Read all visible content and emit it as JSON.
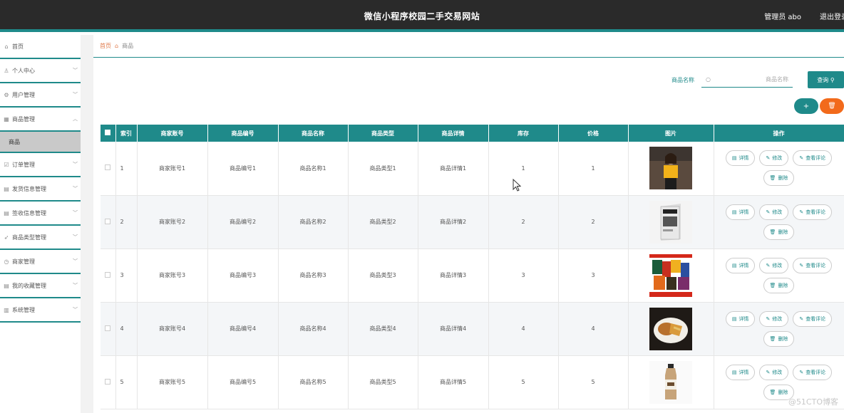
{
  "header": {
    "title": "微信小程序校园二手交易网站",
    "user": "管理员 abo",
    "logout": "退出登录"
  },
  "sidebar": {
    "items": [
      {
        "label": "首页",
        "icon": "home-icon",
        "glyph": "⌂",
        "chevron": false
      },
      {
        "label": "个人中心",
        "icon": "user-icon",
        "glyph": "♙",
        "chevron": true
      },
      {
        "label": "用户管理",
        "icon": "settings-icon",
        "glyph": "⚙",
        "chevron": true
      },
      {
        "label": "商品管理",
        "icon": "box-icon",
        "glyph": "▦",
        "chevron": true,
        "expanded": true,
        "sub": "商品"
      },
      {
        "label": "订单管理",
        "icon": "order-icon",
        "glyph": "☑",
        "chevron": true
      },
      {
        "label": "发货信息管理",
        "icon": "ship-icon",
        "glyph": "▤",
        "chevron": true
      },
      {
        "label": "签收信息管理",
        "icon": "sign-icon",
        "glyph": "▤",
        "chevron": true
      },
      {
        "label": "商品类型管理",
        "icon": "send-icon",
        "glyph": "➶",
        "chevron": true
      },
      {
        "label": "商家管理",
        "icon": "clock-icon",
        "glyph": "◷",
        "chevron": true
      },
      {
        "label": "我的收藏管理",
        "icon": "bookmark-icon",
        "glyph": "▤",
        "chevron": true
      },
      {
        "label": "系统管理",
        "icon": "system-icon",
        "glyph": "▥",
        "chevron": true
      }
    ]
  },
  "breadcrumb": {
    "home": "首页",
    "current": "商品"
  },
  "search": {
    "label": "商品名称",
    "placeholder": "商品名称",
    "button": "查询"
  },
  "actions": {
    "add": "+",
    "delete": "🗑"
  },
  "table": {
    "headers": [
      "",
      "索引",
      "商家账号",
      "商品编号",
      "商品名称",
      "商品类型",
      "商品详情",
      "库存",
      "价格",
      "图片",
      "操作"
    ],
    "rows": [
      {
        "index": "1",
        "merchant": "商家账号1",
        "code": "商品编号1",
        "name": "商品名称1",
        "type": "商品类型1",
        "detail": "商品详情1",
        "stock": "1",
        "price": "1",
        "image": "woman-photo"
      },
      {
        "index": "2",
        "merchant": "商家账号2",
        "code": "商品编号2",
        "name": "商品名称2",
        "type": "商品类型2",
        "detail": "商品详情2",
        "stock": "2",
        "price": "2",
        "image": "book-photo"
      },
      {
        "index": "3",
        "merchant": "商家账号3",
        "code": "商品编号3",
        "name": "商品名称3",
        "type": "商品类型3",
        "detail": "商品详情3",
        "stock": "3",
        "price": "3",
        "image": "snacks-photo"
      },
      {
        "index": "4",
        "merchant": "商家账号4",
        "code": "商品编号4",
        "name": "商品名称4",
        "type": "商品类型4",
        "detail": "商品详情4",
        "stock": "4",
        "price": "4",
        "image": "food-photo"
      },
      {
        "index": "5",
        "merchant": "商家账号5",
        "code": "商品编号5",
        "name": "商品名称5",
        "type": "商品类型5",
        "detail": "商品详情5",
        "stock": "5",
        "price": "5",
        "image": "bottle-photo"
      }
    ],
    "ops": {
      "detail": "详情",
      "edit": "修改",
      "comments": "查看评论",
      "remove": "删除"
    }
  },
  "watermark": "@51CTO博客",
  "colors": {
    "accent": "#1f8a8a",
    "danger": "#f26a1b",
    "topbar": "#2a2a2a"
  }
}
